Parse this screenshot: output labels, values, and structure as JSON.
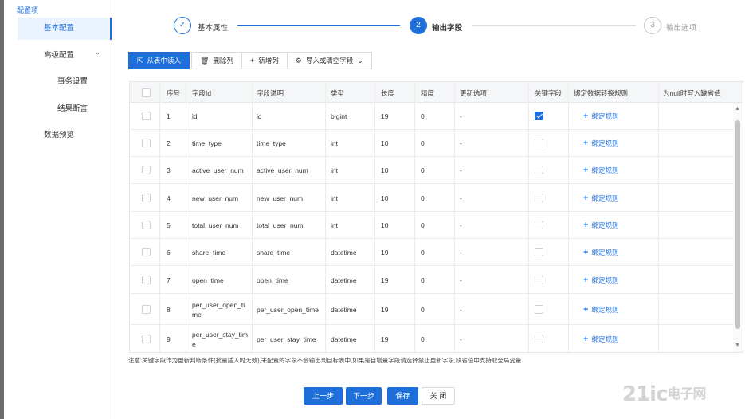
{
  "sidebar": {
    "title": "配置项",
    "items": [
      {
        "label": "基本配置",
        "active": true
      },
      {
        "label": "高级配置",
        "caret": "⌃"
      },
      {
        "label": "事务设置"
      },
      {
        "label": "结果断言"
      },
      {
        "label": "数据预览"
      }
    ]
  },
  "steps": [
    {
      "index": "✓",
      "label": "基本属性",
      "state": "done"
    },
    {
      "index": "2",
      "label": "输出字段",
      "state": "active"
    },
    {
      "index": "3",
      "label": "输出选项",
      "state": "pending"
    }
  ],
  "toolbar": {
    "read_from_table": "从表中读入",
    "delete_column": "删除列",
    "add_column": "新增列",
    "import_or_clear": "导入或清空字段"
  },
  "table": {
    "headers": [
      "序号",
      "字段Id",
      "字段说明",
      "类型",
      "长度",
      "精度",
      "更新选项",
      "关键字段",
      "绑定数据转换规则",
      "为null时写入缺省值"
    ],
    "bind_label": "绑定规则",
    "rows": [
      {
        "no": "1",
        "field_id": "id",
        "desc": "id",
        "type": "bigint",
        "length": "19",
        "precision": "0",
        "update": "-",
        "key": true
      },
      {
        "no": "2",
        "field_id": "time_type",
        "desc": "time_type",
        "type": "int",
        "length": "10",
        "precision": "0",
        "update": "-",
        "key": false
      },
      {
        "no": "3",
        "field_id": "active_user_num",
        "desc": "active_user_num",
        "type": "int",
        "length": "10",
        "precision": "0",
        "update": "-",
        "key": false
      },
      {
        "no": "4",
        "field_id": "new_user_num",
        "desc": "new_user_num",
        "type": "int",
        "length": "10",
        "precision": "0",
        "update": "-",
        "key": false
      },
      {
        "no": "5",
        "field_id": "total_user_num",
        "desc": "total_user_num",
        "type": "int",
        "length": "10",
        "precision": "0",
        "update": "-",
        "key": false
      },
      {
        "no": "6",
        "field_id": "share_time",
        "desc": "share_time",
        "type": "datetime",
        "length": "19",
        "precision": "0",
        "update": "-",
        "key": false
      },
      {
        "no": "7",
        "field_id": "open_time",
        "desc": "open_time",
        "type": "datetime",
        "length": "19",
        "precision": "0",
        "update": "-",
        "key": false
      },
      {
        "no": "8",
        "field_id": "per_user_open_time",
        "desc": "per_user_open_time",
        "type": "datetime",
        "length": "19",
        "precision": "0",
        "update": "-",
        "key": false
      },
      {
        "no": "9",
        "field_id": "per_user_stay_time",
        "desc": "per_user_stay_time",
        "type": "datetime",
        "length": "19",
        "precision": "0",
        "update": "-",
        "key": false
      }
    ]
  },
  "note": "注意:关键字段作为更新判断条件(批量插入时无效),未配置的字段不会输出到目标表中,如果是自增量字段请选择禁止更新字段,缺省值中支持取全局变量",
  "footer": {
    "prev": "上一步",
    "next": "下一步",
    "save": "保存",
    "close": "关 闭"
  },
  "watermark": {
    "main": "21ic",
    "sub": "电子网"
  },
  "colors": {
    "primary": "#1e6fd9",
    "header_bg": "#f5f6f8"
  }
}
